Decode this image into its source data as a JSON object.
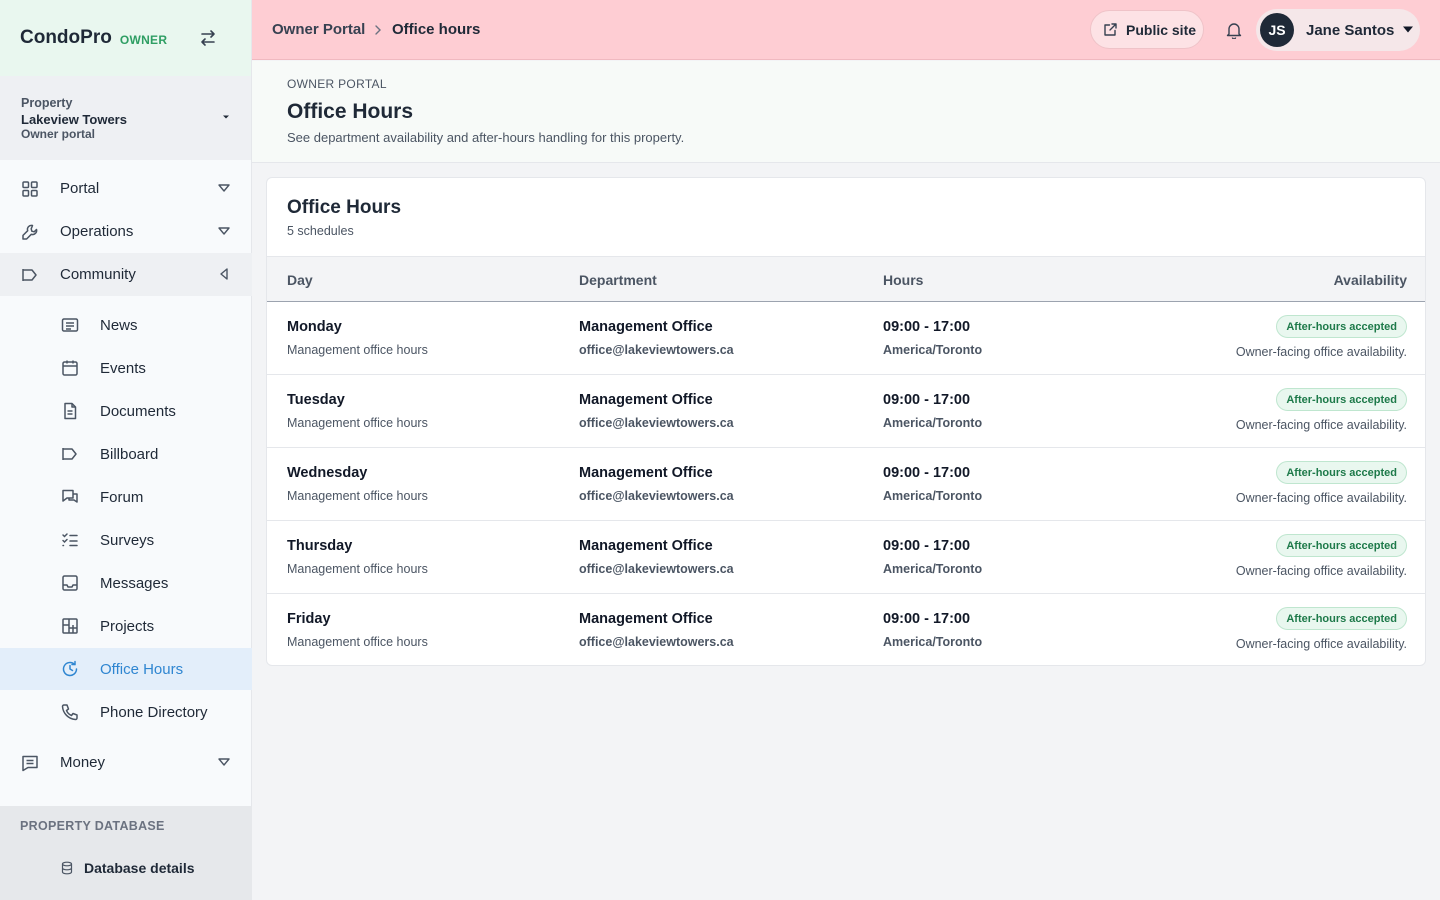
{
  "brand": {
    "name": "CondoPro",
    "role": "OWNER"
  },
  "property": {
    "label": "Property",
    "name": "Lakeview Towers",
    "sub": "Owner portal"
  },
  "nav": {
    "portal": "Portal",
    "operations": "Operations",
    "community": "Community",
    "community_items": [
      "News",
      "Events",
      "Documents",
      "Billboard",
      "Forum",
      "Surveys",
      "Messages",
      "Projects",
      "Office Hours",
      "Phone Directory"
    ],
    "money": "Money",
    "db_heading": "PROPERTY DATABASE",
    "db_item": "Database details"
  },
  "header": {
    "crumbs": [
      "Owner Portal",
      "Office hours"
    ],
    "public_site": "Public site",
    "user": {
      "initials": "JS",
      "name": "Jane Santos"
    }
  },
  "page": {
    "eyebrow": "OWNER PORTAL",
    "title": "Office Hours",
    "subtitle": "See department availability and after-hours handling for this property."
  },
  "card": {
    "title": "Office Hours",
    "count": "5 schedules",
    "columns": [
      "Day",
      "Department",
      "Hours",
      "Availability"
    ],
    "rows": [
      {
        "day": "Monday",
        "day_sub": "Management office hours",
        "dept": "Management Office",
        "email": "office@lakeviewtowers.ca",
        "hours": "09:00 - 17:00",
        "tz": "America/Toronto",
        "badge": "After-hours accepted",
        "note": "Owner-facing office availability."
      },
      {
        "day": "Tuesday",
        "day_sub": "Management office hours",
        "dept": "Management Office",
        "email": "office@lakeviewtowers.ca",
        "hours": "09:00 - 17:00",
        "tz": "America/Toronto",
        "badge": "After-hours accepted",
        "note": "Owner-facing office availability."
      },
      {
        "day": "Wednesday",
        "day_sub": "Management office hours",
        "dept": "Management Office",
        "email": "office@lakeviewtowers.ca",
        "hours": "09:00 - 17:00",
        "tz": "America/Toronto",
        "badge": "After-hours accepted",
        "note": "Owner-facing office availability."
      },
      {
        "day": "Thursday",
        "day_sub": "Management office hours",
        "dept": "Management Office",
        "email": "office@lakeviewtowers.ca",
        "hours": "09:00 - 17:00",
        "tz": "America/Toronto",
        "badge": "After-hours accepted",
        "note": "Owner-facing office availability."
      },
      {
        "day": "Friday",
        "day_sub": "Management office hours",
        "dept": "Management Office",
        "email": "office@lakeviewtowers.ca",
        "hours": "09:00 - 17:00",
        "tz": "America/Toronto",
        "badge": "After-hours accepted",
        "note": "Owner-facing office availability."
      }
    ]
  },
  "colors": {
    "accent": "#2f86d1",
    "header_bg": "#fecdd3",
    "badge_green": "#1e7a4a"
  }
}
